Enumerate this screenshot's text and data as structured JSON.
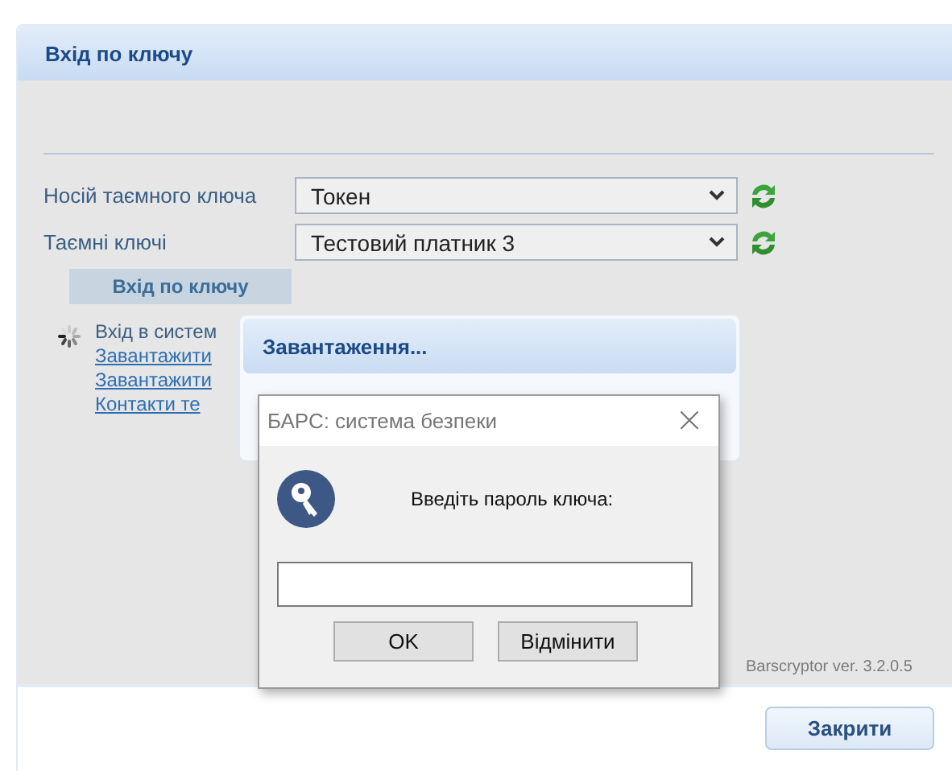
{
  "window": {
    "title": "Вхід по ключу"
  },
  "form": {
    "fields": [
      {
        "label": "Носій таємного ключа",
        "value": "Токен"
      },
      {
        "label": "Таємні ключі",
        "value": "Тестовий платник 3"
      }
    ],
    "submit": "Вхід по ключу"
  },
  "status": {
    "text": "Вхід в систем",
    "links": [
      "Завантажити",
      "Завантажити",
      "Контакти те"
    ]
  },
  "version": "Barscryptor ver. 3.2.0.5",
  "footer": {
    "button": "Закрити"
  },
  "loading": {
    "title": "Завантаження..."
  },
  "dialog": {
    "title": "БАРС: система безпеки",
    "close": "×",
    "prompt": "Введіть пароль ключа:",
    "buttons": [
      "OK",
      "Відмінити"
    ]
  }
}
